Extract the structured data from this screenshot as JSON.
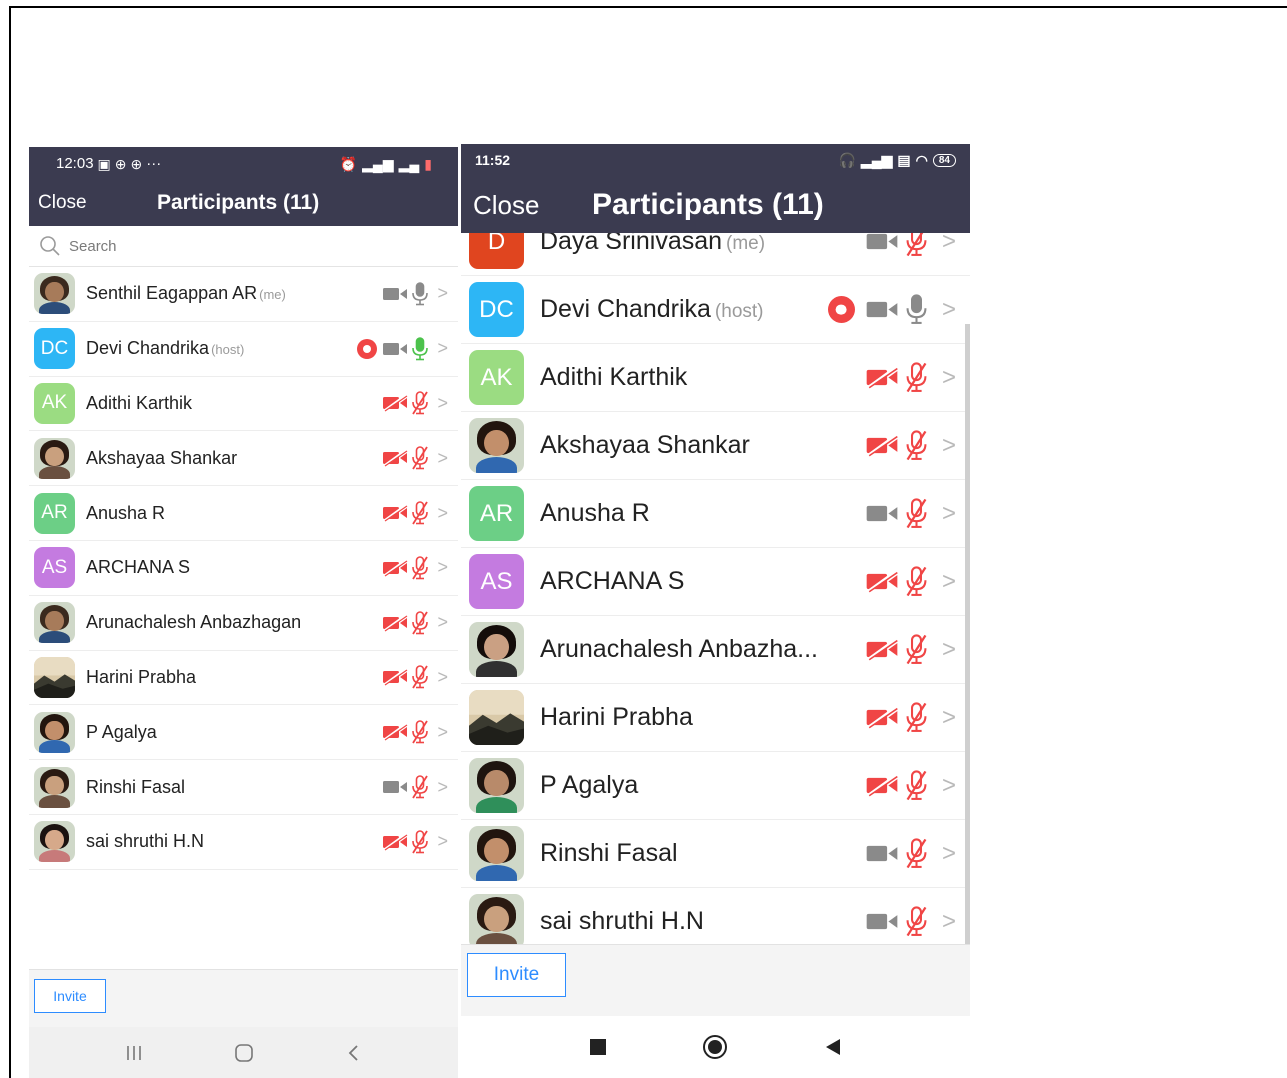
{
  "left": {
    "status": {
      "time": "12:03",
      "extra": "···"
    },
    "header": {
      "close": "Close",
      "title": "Participants (11)"
    },
    "search": {
      "placeholder": "Search"
    },
    "participants": [
      {
        "name": "Senthil Eagappan AR",
        "role": "(me)",
        "avatar": "photo",
        "video": "on",
        "mic": "on",
        "rec": false
      },
      {
        "name": "Devi Chandrika",
        "role": "(host)",
        "avatar": "DC",
        "color": "#2db6f5",
        "video": "on",
        "mic": "active",
        "rec": true
      },
      {
        "name": "Adithi Karthik",
        "role": "",
        "avatar": "AK",
        "color": "#9bdc82",
        "video": "off",
        "mic": "off",
        "rec": false
      },
      {
        "name": "Akshayaa Shankar",
        "role": "",
        "avatar": "photo",
        "video": "off",
        "mic": "off",
        "rec": false
      },
      {
        "name": "Anusha R",
        "role": "",
        "avatar": "AR",
        "color": "#6ccf86",
        "video": "off",
        "mic": "off",
        "rec": false
      },
      {
        "name": "ARCHANA S",
        "role": "",
        "avatar": "AS",
        "color": "#c47be0",
        "video": "off",
        "mic": "off",
        "rec": false
      },
      {
        "name": "Arunachalesh Anbazhagan",
        "role": "",
        "avatar": "photo",
        "video": "off",
        "mic": "off",
        "rec": false
      },
      {
        "name": "Harini Prabha",
        "role": "",
        "avatar": "landscape",
        "video": "off",
        "mic": "off",
        "rec": false
      },
      {
        "name": "P Agalya",
        "role": "",
        "avatar": "photo",
        "video": "off",
        "mic": "off",
        "rec": false
      },
      {
        "name": "Rinshi Fasal",
        "role": "",
        "avatar": "photo",
        "video": "on",
        "mic": "off",
        "rec": false
      },
      {
        "name": "sai shruthi H.N",
        "role": "",
        "avatar": "photo",
        "video": "off",
        "mic": "off",
        "rec": false
      }
    ],
    "invite": "Invite"
  },
  "right": {
    "status": {
      "time": "11:52",
      "battery": "84"
    },
    "header": {
      "close": "Close",
      "title": "Participants (11)"
    },
    "cutoff": {
      "name": "Daya Srinivasan",
      "role": "(me)",
      "avatar": "D"
    },
    "participants": [
      {
        "name": "Devi Chandrika",
        "role": "(host)",
        "avatar": "DC",
        "color": "#2db6f5",
        "video": "on",
        "mic": "on",
        "rec": true
      },
      {
        "name": "Adithi Karthik",
        "role": "",
        "avatar": "AK",
        "color": "#9bdc82",
        "video": "off",
        "mic": "off",
        "rec": false
      },
      {
        "name": "Akshayaa Shankar",
        "role": "",
        "avatar": "photo",
        "video": "off",
        "mic": "off",
        "rec": false
      },
      {
        "name": "Anusha R",
        "role": "",
        "avatar": "AR",
        "color": "#6ccf86",
        "video": "on",
        "mic": "off",
        "rec": false
      },
      {
        "name": "ARCHANA S",
        "role": "",
        "avatar": "AS",
        "color": "#c47be0",
        "video": "off",
        "mic": "off",
        "rec": false
      },
      {
        "name": "Arunachalesh Anbazha...",
        "role": "",
        "avatar": "photo",
        "video": "off",
        "mic": "off",
        "rec": false
      },
      {
        "name": "Harini Prabha",
        "role": "",
        "avatar": "landscape",
        "video": "off",
        "mic": "off",
        "rec": false
      },
      {
        "name": "P Agalya",
        "role": "",
        "avatar": "photo",
        "video": "off",
        "mic": "off",
        "rec": false
      },
      {
        "name": "Rinshi Fasal",
        "role": "",
        "avatar": "photo",
        "video": "on",
        "mic": "off",
        "rec": false
      },
      {
        "name": "sai shruthi H.N",
        "role": "",
        "avatar": "photo",
        "video": "on",
        "mic": "off",
        "rec": false
      }
    ],
    "invite": "Invite"
  },
  "colors": {
    "header": "#3b3b50",
    "accent": "#2d8cff",
    "muted": "#f04545",
    "icon": "#8a8a8a",
    "mic_active": "#4cc24c"
  }
}
